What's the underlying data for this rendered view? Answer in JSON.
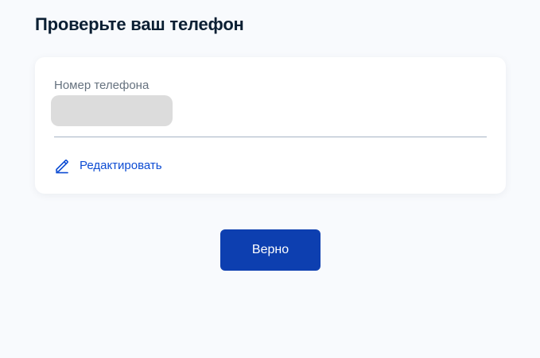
{
  "page": {
    "title": "Проверьте ваш телефон"
  },
  "phone_card": {
    "label": "Номер телефона",
    "value_redacted": true,
    "edit_label": "Редактировать",
    "edit_icon": "pencil-icon"
  },
  "actions": {
    "confirm_label": "Верно"
  },
  "colors": {
    "background": "#f8fafd",
    "title": "#0b1f33",
    "label": "#66727f",
    "link": "#0d4cd3",
    "button": "#0d3fb0",
    "redaction": "#dcdcdc"
  }
}
